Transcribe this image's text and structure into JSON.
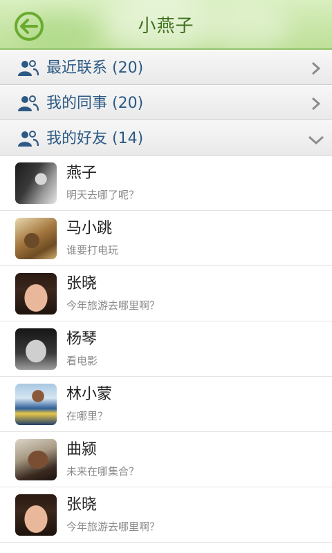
{
  "header": {
    "title": "小燕子",
    "back_icon": "back-arrow-icon",
    "accent": "#7ab648"
  },
  "groups": [
    {
      "label": "最近联系 (20)",
      "icon": "people-icon",
      "state": "collapsed"
    },
    {
      "label": "我的同事 (20)",
      "icon": "people-icon",
      "state": "collapsed"
    },
    {
      "label": "我的好友 (14)",
      "icon": "people-icon",
      "state": "expanded"
    }
  ],
  "contacts": [
    {
      "name": "燕子",
      "message": "明天去哪了呢？"
    },
    {
      "name": "马小跳",
      "message": "谁要打电玩"
    },
    {
      "name": "张晓",
      "message": "今年旅游去哪里啊？"
    },
    {
      "name": "杨琴",
      "message": "看电影"
    },
    {
      "name": "林小蒙",
      "message": "在哪里？"
    },
    {
      "name": "曲颍",
      "message": "未来在哪集合？"
    },
    {
      "name": "张晓",
      "message": "今年旅游去哪里啊？"
    }
  ]
}
